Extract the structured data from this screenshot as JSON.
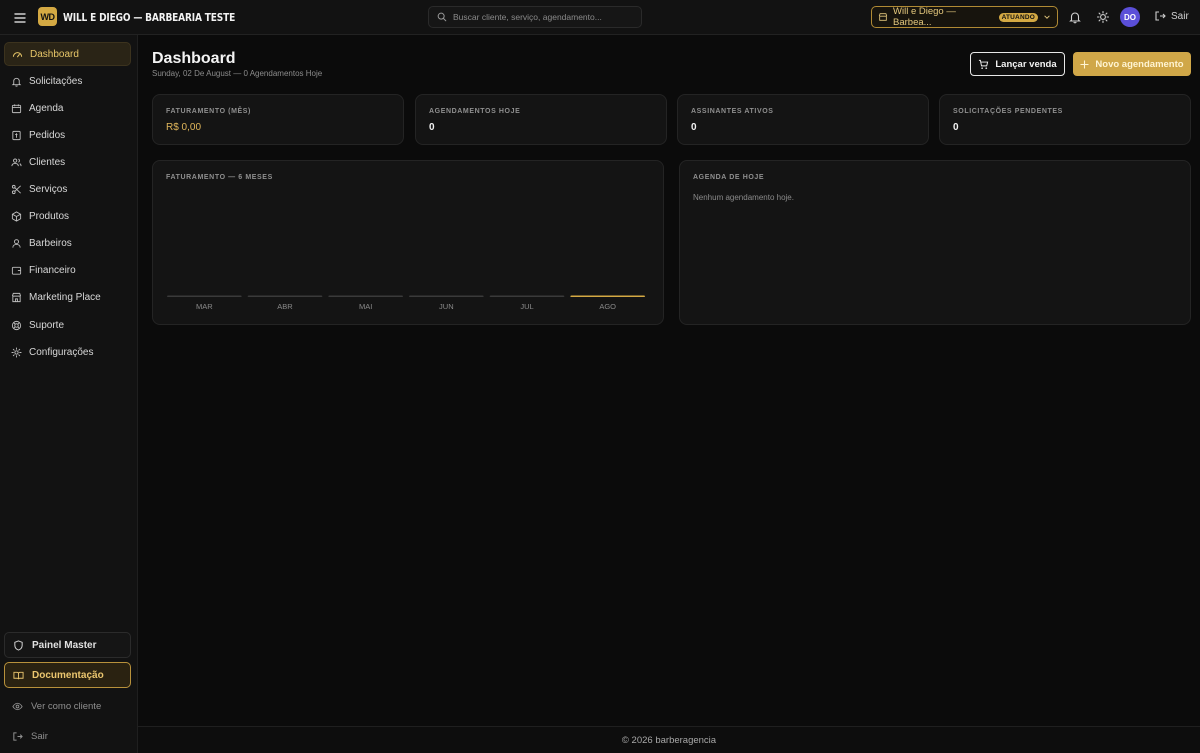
{
  "topbar": {
    "logo_text": "WD",
    "brand": "Will e Diego — Barbearia Teste",
    "search_placeholder": "Buscar cliente, serviço, agendamento...",
    "shop_name": "Will e Diego — Barbea...",
    "shop_badge": "ATUANDO",
    "avatar_initials": "DO",
    "logout_label": "Sair"
  },
  "sidebar": {
    "items": [
      {
        "label": "Dashboard",
        "icon": "gauge-icon",
        "active": true
      },
      {
        "label": "Solicitações",
        "icon": "bell-icon"
      },
      {
        "label": "Agenda",
        "icon": "calendar-icon"
      },
      {
        "label": "Pedidos",
        "icon": "receipt-icon"
      },
      {
        "label": "Clientes",
        "icon": "users-icon"
      },
      {
        "label": "Serviços",
        "icon": "scissors-icon"
      },
      {
        "label": "Produtos",
        "icon": "package-icon"
      },
      {
        "label": "Barbeiros",
        "icon": "user-icon"
      },
      {
        "label": "Financeiro",
        "icon": "wallet-icon"
      },
      {
        "label": "Marketing Place",
        "icon": "store-icon"
      },
      {
        "label": "Suporte",
        "icon": "lifebuoy-icon"
      },
      {
        "label": "Configurações",
        "icon": "gear-icon"
      }
    ],
    "master_label": "Painel Master",
    "docs_label": "Documentação",
    "client_view_label": "Ver como cliente",
    "logout_label": "Sair"
  },
  "header": {
    "title": "Dashboard",
    "subtitle": "Sunday, 02 De August — 0 Agendamentos Hoje",
    "sale_button": "Lançar venda",
    "new_booking_button": "Novo agendamento"
  },
  "stats": [
    {
      "label": "Faturamento (mês)",
      "value": "R$ 0,00"
    },
    {
      "label": "Agendamentos hoje",
      "value": "0"
    },
    {
      "label": "Assinantes ativos",
      "value": "0"
    },
    {
      "label": "Solicitações pendentes",
      "value": "0"
    }
  ],
  "revenue_panel": {
    "title": "Faturamento — 6 meses"
  },
  "agenda_panel": {
    "title": "Agenda de hoje",
    "empty_text": "Nenhum agendamento hoje."
  },
  "chart_data": {
    "type": "bar",
    "categories": [
      "MAR",
      "ABR",
      "MAI",
      "JUN",
      "JUL",
      "AGO"
    ],
    "values": [
      0,
      0,
      0,
      0,
      0,
      0
    ],
    "highlight_index": 5,
    "bar_color": "#3a3a3a",
    "highlight_color": "#d4a943"
  },
  "footer": {
    "text": "© 2026 barberagencia"
  },
  "colors": {
    "accent": "#d4a943",
    "background": "#0b0b0b",
    "surface": "#141414"
  }
}
